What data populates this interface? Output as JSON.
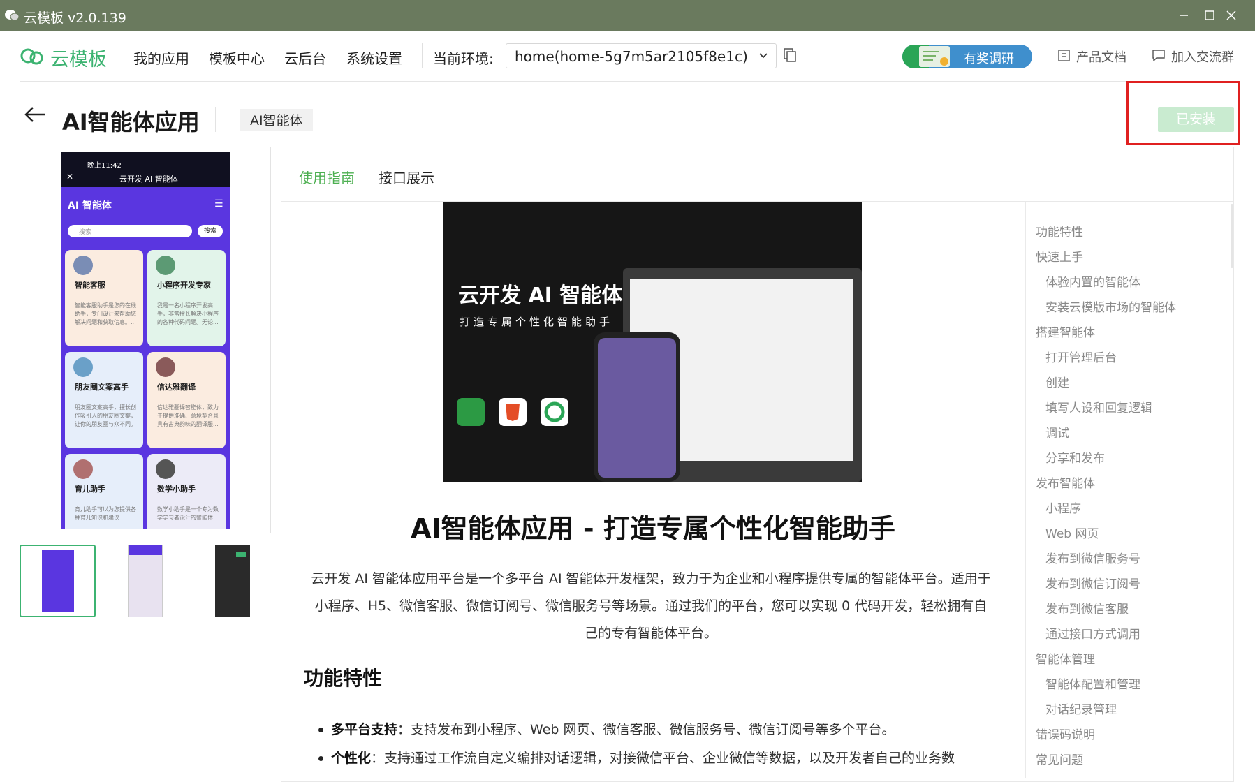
{
  "window": {
    "title": "云模板 v2.0.139"
  },
  "nav": {
    "logo": "云模板",
    "items": [
      "我的应用",
      "模板中心",
      "云后台",
      "系统设置"
    ],
    "env_label": "当前环境:",
    "env_value": "home(home-5g7m5ar2105f8e1c)",
    "survey": "有奖调研",
    "docs": "产品文档",
    "community": "加入交流群"
  },
  "header": {
    "title": "AI智能体应用",
    "tag": "AI智能体",
    "installed": "已安装"
  },
  "preview": {
    "status_time": "晚上11:42",
    "app_title": "云开发 AI 智能体",
    "app_header": "AI  智能体",
    "search_placeholder": "搜索",
    "search_button": "搜索",
    "cards": [
      {
        "name": "智能客服",
        "desc": "智能客服助手是您的在线助手，专门设计来帮助您解决问题和获取信息。..."
      },
      {
        "name": "小程序开发专家",
        "desc": "我是一名小程序开发高手，非常擅长解决小程序的各种代码问题。无论..."
      },
      {
        "name": "朋友圈文案高手",
        "desc": "朋友圈文案高手，擅长创作吸引人的朋友圈文案，让你的朋友圈与众不同。"
      },
      {
        "name": "信达雅翻译",
        "desc": "信达雅翻译智能体，致力于提供准确、意境契合且具有古典韵味的翻译服..."
      },
      {
        "name": "育儿助手",
        "desc": "育儿助手可以为您提供各种育儿知识和建议..."
      },
      {
        "name": "数学小助手",
        "desc": "数学小助手是一个专为数学学习者设计的智能体..."
      }
    ]
  },
  "tabs": [
    "使用指南",
    "接口展示"
  ],
  "hero": {
    "title": "云开发 AI 智能体",
    "subtitle": "打造专属个性化智能助手"
  },
  "article": {
    "title": "AI智能体应用 - 打造专属个性化智能助手",
    "intro": [
      "云开发 AI 智能体应用平台是一个多平台 AI 智能体开发框架，致力于为企业和小程序提供专属的智能体平台。适用于",
      "小程序、H5、微信客服、微信订阅号、微信服务号等场景。通过我们的平台，您可以实现 0 代码开发，轻松拥有自",
      "己的专有智能体平台。"
    ],
    "section_title": "功能特性",
    "bullets": [
      {
        "bold": "多平台支持",
        "text": "：支持发布到小程序、Web 网页、微信客服、微信服务号、微信订阅号等多个平台。"
      },
      {
        "bold": "个性化",
        "text": "：支持通过工作流自定义编排对话逻辑，对接微信平台、企业微信等数据，以及开发者自己的业务数"
      }
    ]
  },
  "toc": [
    {
      "label": "功能特性",
      "level": 1
    },
    {
      "label": "快速上手",
      "level": 1
    },
    {
      "label": "体验内置的智能体",
      "level": 2
    },
    {
      "label": "安装云模版市场的智能体",
      "level": 2
    },
    {
      "label": "搭建智能体",
      "level": 1
    },
    {
      "label": "打开管理后台",
      "level": 2
    },
    {
      "label": "创建",
      "level": 2
    },
    {
      "label": "填写人设和回复逻辑",
      "level": 2
    },
    {
      "label": "调试",
      "level": 2
    },
    {
      "label": "分享和发布",
      "level": 2
    },
    {
      "label": "发布智能体",
      "level": 1
    },
    {
      "label": "小程序",
      "level": 2
    },
    {
      "label": "Web 网页",
      "level": 2
    },
    {
      "label": "发布到微信服务号",
      "level": 2
    },
    {
      "label": "发布到微信订阅号",
      "level": 2
    },
    {
      "label": "发布到微信客服",
      "level": 2
    },
    {
      "label": "通过接口方式调用",
      "level": 2
    },
    {
      "label": "智能体管理",
      "level": 1
    },
    {
      "label": "智能体配置和管理",
      "level": 2
    },
    {
      "label": "对话纪录管理",
      "level": 2
    },
    {
      "label": "错误码说明",
      "level": 1
    },
    {
      "label": "常见问题",
      "level": 1
    }
  ],
  "colors": {
    "brand_green": "#3cb371",
    "active_tab": "#4caf50",
    "highlight_red": "#e02020",
    "installed_bg": "#c9ebd0"
  }
}
